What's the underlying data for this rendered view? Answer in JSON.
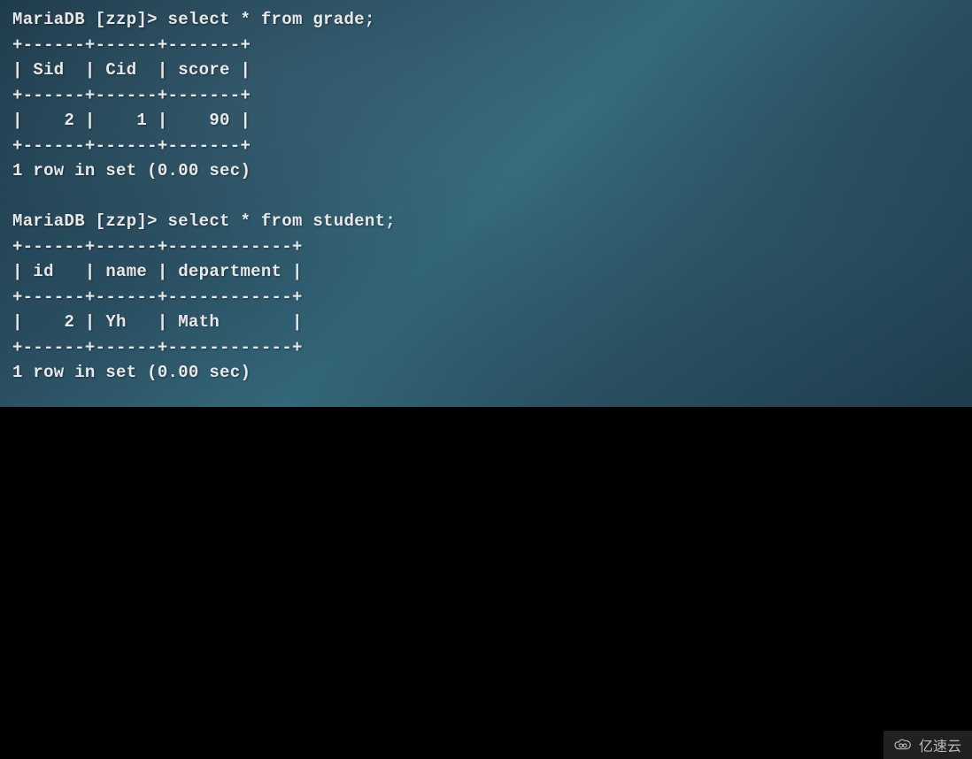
{
  "query1": {
    "prompt": "MariaDB [zzp]> ",
    "sql": "select * from grade;",
    "border_top": "+------+------+-------+",
    "header": "| Sid  | Cid  | score |",
    "border_mid": "+------+------+-------+",
    "row1": "|    2 |    1 |    90 |",
    "border_bot": "+------+------+-------+",
    "result": "1 row in set (0.00 sec)"
  },
  "query2": {
    "prompt": "MariaDB [zzp]> ",
    "sql": "select * from student;",
    "border_top": "+------+------+------------+",
    "header": "| id   | name | department |",
    "border_mid": "+------+------+------------+",
    "row1": "|    2 | Yh   | Math       |",
    "border_bot": "+------+------+------------+",
    "result": "1 row in set (0.00 sec)"
  },
  "watermark": {
    "text": "亿速云"
  },
  "chart_data": [
    {
      "type": "table",
      "title": "grade",
      "columns": [
        "Sid",
        "Cid",
        "score"
      ],
      "rows": [
        [
          2,
          1,
          90
        ]
      ]
    },
    {
      "type": "table",
      "title": "student",
      "columns": [
        "id",
        "name",
        "department"
      ],
      "rows": [
        [
          2,
          "Yh",
          "Math"
        ]
      ]
    }
  ]
}
